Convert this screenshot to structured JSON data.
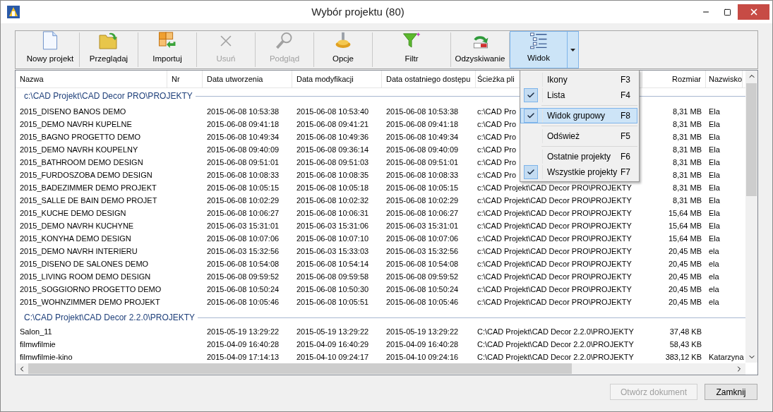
{
  "window": {
    "title": "Wybór projektu (80)"
  },
  "toolbar": [
    {
      "label": "Nowy projekt",
      "kind": "new",
      "disabled": false,
      "pressed": false
    },
    {
      "label": "Przeglądaj",
      "kind": "browse",
      "disabled": false,
      "pressed": false
    },
    {
      "label": "Importuj",
      "kind": "import",
      "disabled": false,
      "pressed": false
    },
    {
      "label": "Usuń",
      "kind": "delete",
      "disabled": true,
      "pressed": false
    },
    {
      "label": "Podgląd",
      "kind": "preview",
      "disabled": true,
      "pressed": false
    },
    {
      "label": "Opcje",
      "kind": "options",
      "disabled": false,
      "pressed": false
    },
    {
      "label": "Filtr",
      "kind": "filter",
      "disabled": false,
      "pressed": false
    },
    {
      "label": "Odzyskiwanie",
      "kind": "recover",
      "disabled": false,
      "pressed": false
    },
    {
      "label": "Widok",
      "kind": "view",
      "disabled": false,
      "pressed": true
    }
  ],
  "table": {
    "columns": [
      "Nazwa",
      "Nr",
      "Data utworzenia",
      "Data modyfikacji",
      "Data ostatniego dostępu",
      "Ścieżka pli",
      "Rozmiar",
      "Nazwisko"
    ],
    "groups": [
      {
        "label": "c:\\CAD Projekt\\CAD Decor PRO\\PROJEKTY",
        "rows": [
          {
            "name": "2015_DISENO BANOS DEMO",
            "created": "2015-06-08 10:53:38",
            "modified": "2015-06-08 10:53:40",
            "accessed": "2015-06-08 10:53:38",
            "path": "c:\\CAD Pro",
            "size": "8,31 MB",
            "author": "Ela"
          },
          {
            "name": "2015_DEMO NAVRH KUPELNE",
            "created": "2015-06-08 09:41:18",
            "modified": "2015-06-08 09:41:21",
            "accessed": "2015-06-08 09:41:18",
            "path": "c:\\CAD Pro",
            "size": "8,31 MB",
            "author": "Ela"
          },
          {
            "name": "2015_BAGNO PROGETTO DEMO",
            "created": "2015-06-08 10:49:34",
            "modified": "2015-06-08 10:49:36",
            "accessed": "2015-06-08 10:49:34",
            "path": "c:\\CAD Pro",
            "size": "8,31 MB",
            "author": "Ela"
          },
          {
            "name": "2015_DEMO NAVRH KOUPELNY",
            "created": "2015-06-08 09:40:09",
            "modified": "2015-06-08 09:36:14",
            "accessed": "2015-06-08 09:40:09",
            "path": "c:\\CAD Pro",
            "size": "8,31 MB",
            "author": "Ela"
          },
          {
            "name": "2015_BATHROOM DEMO DESIGN",
            "created": "2015-06-08 09:51:01",
            "modified": "2015-06-08 09:51:03",
            "accessed": "2015-06-08 09:51:01",
            "path": "c:\\CAD Pro",
            "size": "8,31 MB",
            "author": "Ela"
          },
          {
            "name": "2015_FURDOSZOBA DEMO DESIGN",
            "created": "2015-06-08 10:08:33",
            "modified": "2015-06-08 10:08:35",
            "accessed": "2015-06-08 10:08:33",
            "path": "c:\\CAD Pro",
            "size": "8,31 MB",
            "author": "Ela"
          },
          {
            "name": "2015_BADEZIMMER DEMO PROJEKT",
            "created": "2015-06-08 10:05:15",
            "modified": "2015-06-08 10:05:18",
            "accessed": "2015-06-08 10:05:15",
            "path": "c:\\CAD Projekt\\CAD Decor PRO\\PROJEKTY",
            "size": "8,31 MB",
            "author": "Ela"
          },
          {
            "name": "2015_SALLE DE BAIN DEMO PROJET",
            "created": "2015-06-08 10:02:29",
            "modified": "2015-06-08 10:02:32",
            "accessed": "2015-06-08 10:02:29",
            "path": "c:\\CAD Projekt\\CAD Decor PRO\\PROJEKTY",
            "size": "8,31 MB",
            "author": "Ela"
          },
          {
            "name": "2015_KUCHE DEMO DESIGN",
            "created": "2015-06-08 10:06:27",
            "modified": "2015-06-08 10:06:31",
            "accessed": "2015-06-08 10:06:27",
            "path": "c:\\CAD Projekt\\CAD Decor PRO\\PROJEKTY",
            "size": "15,64 MB",
            "author": "Ela"
          },
          {
            "name": "2015_DEMO NAVRH KUCHYNE",
            "created": "2015-06-03 15:31:01",
            "modified": "2015-06-03 15:31:06",
            "accessed": "2015-06-03 15:31:01",
            "path": "c:\\CAD Projekt\\CAD Decor PRO\\PROJEKTY",
            "size": "15,64 MB",
            "author": "Ela"
          },
          {
            "name": "2015_KONYHA DEMO DESIGN",
            "created": "2015-06-08 10:07:06",
            "modified": "2015-06-08 10:07:10",
            "accessed": "2015-06-08 10:07:06",
            "path": "c:\\CAD Projekt\\CAD Decor PRO\\PROJEKTY",
            "size": "15,64 MB",
            "author": "Ela"
          },
          {
            "name": "2015_DEMO NAVRH INTERIERU",
            "created": "2015-06-03 15:32:56",
            "modified": "2015-06-03 15:33:03",
            "accessed": "2015-06-03 15:32:56",
            "path": "c:\\CAD Projekt\\CAD Decor PRO\\PROJEKTY",
            "size": "20,45 MB",
            "author": "ela"
          },
          {
            "name": "2015_DISENO DE SALONES DEMO",
            "created": "2015-06-08 10:54:08",
            "modified": "2015-06-08 10:54:14",
            "accessed": "2015-06-08 10:54:08",
            "path": "c:\\CAD Projekt\\CAD Decor PRO\\PROJEKTY",
            "size": "20,45 MB",
            "author": "ela"
          },
          {
            "name": "2015_LIVING ROOM DEMO DESIGN",
            "created": "2015-06-08 09:59:52",
            "modified": "2015-06-08 09:59:58",
            "accessed": "2015-06-08 09:59:52",
            "path": "c:\\CAD Projekt\\CAD Decor PRO\\PROJEKTY",
            "size": "20,45 MB",
            "author": "ela"
          },
          {
            "name": "2015_SOGGIORNO PROGETTO DEMO",
            "created": "2015-06-08 10:50:24",
            "modified": "2015-06-08 10:50:30",
            "accessed": "2015-06-08 10:50:24",
            "path": "c:\\CAD Projekt\\CAD Decor PRO\\PROJEKTY",
            "size": "20,45 MB",
            "author": "ela"
          },
          {
            "name": "2015_WOHNZIMMER DEMO PROJEKT",
            "created": "2015-06-08 10:05:46",
            "modified": "2015-06-08 10:05:51",
            "accessed": "2015-06-08 10:05:46",
            "path": "c:\\CAD Projekt\\CAD Decor PRO\\PROJEKTY",
            "size": "20,45 MB",
            "author": "ela"
          }
        ]
      },
      {
        "label": "C:\\CAD Projekt\\CAD Decor 2.2.0\\PROJEKTY",
        "rows": [
          {
            "name": "Salon_11",
            "created": "2015-05-19 13:29:22",
            "modified": "2015-05-19 13:29:22",
            "accessed": "2015-05-19 13:29:22",
            "path": "C:\\CAD Projekt\\CAD Decor 2.2.0\\PROJEKTY",
            "size": "37,48 KB"
          },
          {
            "name": "filmwfilmie",
            "created": "2015-04-09 16:40:28",
            "modified": "2015-04-09 16:40:29",
            "accessed": "2015-04-09 16:40:28",
            "path": "C:\\CAD Projekt\\CAD Decor 2.2.0\\PROJEKTY",
            "size": "58,43 KB"
          },
          {
            "name": "filmwfilmie-kino",
            "created": "2015-04-09 17:14:13",
            "modified": "2015-04-10 09:24:17",
            "accessed": "2015-04-10 09:24:16",
            "path": "C:\\CAD Projekt\\CAD Decor 2.2.0\\PROJEKTY",
            "size": "383,12 KB",
            "author": "Katarzyna"
          }
        ]
      }
    ]
  },
  "menu": [
    {
      "kind": "command",
      "label": "Ikony",
      "shortcut": "F3",
      "checked": false,
      "selected": false
    },
    {
      "kind": "command",
      "label": "Lista",
      "shortcut": "F4",
      "checked": true,
      "selected": false
    },
    {
      "kind": "separator"
    },
    {
      "kind": "command",
      "label": "Widok grupowy",
      "shortcut": "F8",
      "checked": true,
      "selected": true
    },
    {
      "kind": "separator"
    },
    {
      "kind": "command",
      "label": "Odśwież",
      "shortcut": "F5",
      "checked": false,
      "selected": false
    },
    {
      "kind": "separator"
    },
    {
      "kind": "command",
      "label": "Ostatnie projekty",
      "shortcut": "F6",
      "checked": false,
      "selected": false
    },
    {
      "kind": "command",
      "label": "Wszystkie projekty",
      "shortcut": "F7",
      "checked": true,
      "selected": false
    }
  ],
  "buttons": [
    {
      "label": "Otwórz dokument",
      "disabled": true
    },
    {
      "label": "Zamknij",
      "disabled": false
    }
  ]
}
